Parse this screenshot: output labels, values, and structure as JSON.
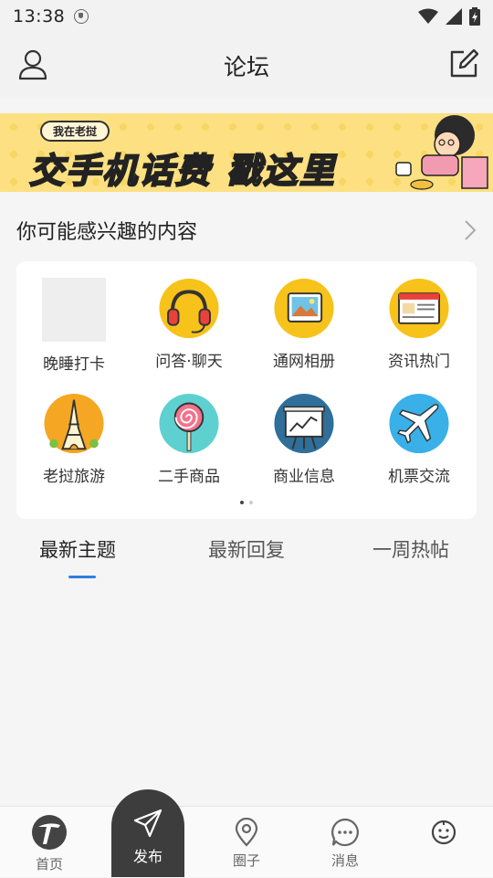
{
  "status_bar": {
    "time": "13:38"
  },
  "header": {
    "title": "论坛"
  },
  "banner": {
    "tag": "我在老挝",
    "headline": "交手机话费",
    "headline_highlight": "戳这里"
  },
  "section": {
    "title": "你可能感兴趣的内容"
  },
  "grid": {
    "items": [
      {
        "label": "晚睡打卡",
        "icon": "placeholder-image"
      },
      {
        "label": "问答·聊天",
        "icon": "headphones-icon"
      },
      {
        "label": "通网相册",
        "icon": "photo-album-icon"
      },
      {
        "label": "资讯热门",
        "icon": "news-icon"
      },
      {
        "label": "老挝旅游",
        "icon": "eiffel-tower-icon"
      },
      {
        "label": "二手商品",
        "icon": "lollipop-icon"
      },
      {
        "label": "商业信息",
        "icon": "business-chart-icon"
      },
      {
        "label": "机票交流",
        "icon": "airplane-icon"
      }
    ],
    "page_count": 2,
    "active_page": 1
  },
  "tabs": [
    {
      "label": "最新主题",
      "active": true
    },
    {
      "label": "最新回复",
      "active": false
    },
    {
      "label": "一周热帖",
      "active": false
    }
  ],
  "bottom_nav": {
    "home": "首页",
    "publish": "发布",
    "circles": "圈子",
    "messages": "消息"
  },
  "colors": {
    "accent": "#2f7fe0",
    "icon_yellow": "#f7c21a",
    "banner_bg": "#fce082",
    "publish_bg": "#3d3d3d"
  }
}
